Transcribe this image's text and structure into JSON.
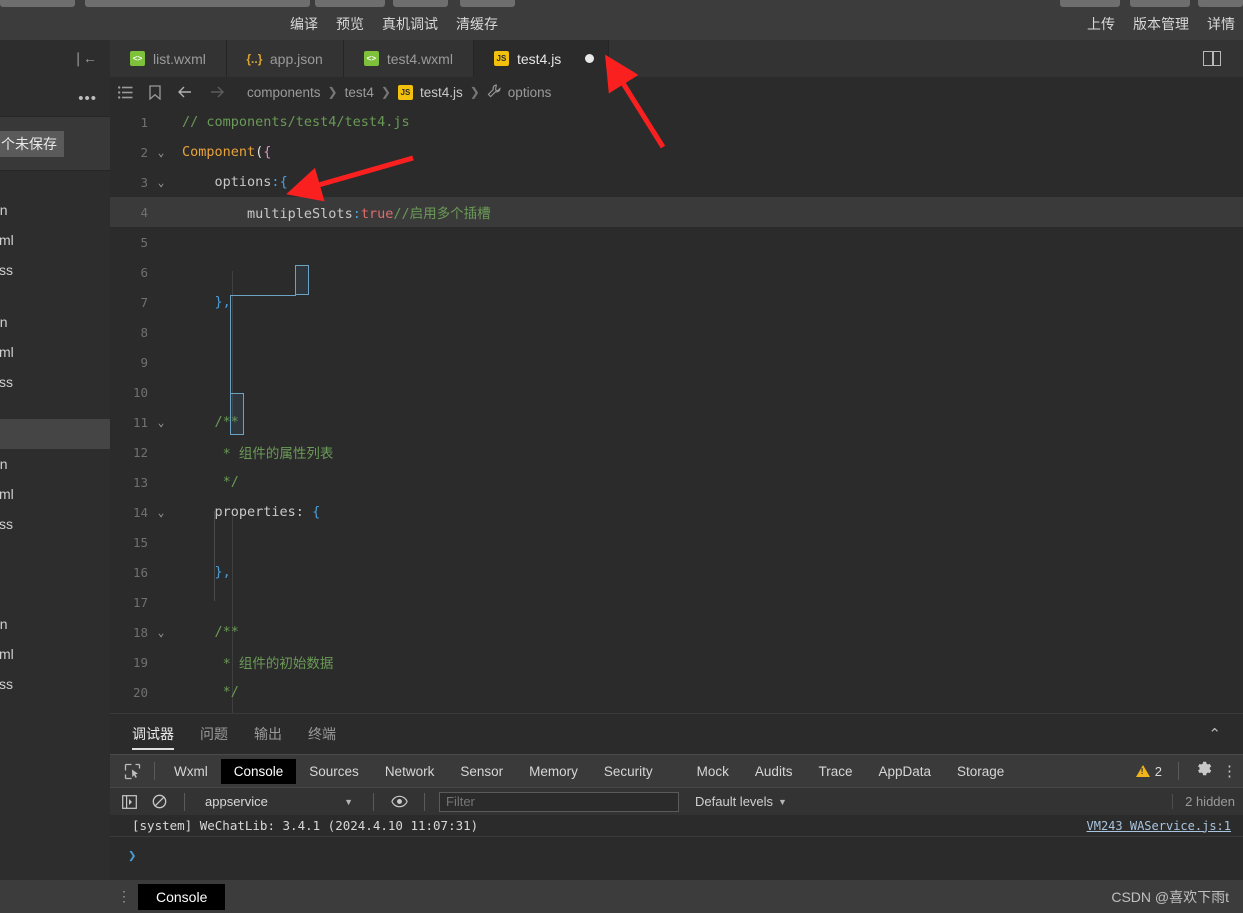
{
  "menubar": {
    "center_items": [
      "编译",
      "预览",
      "真机调试",
      "清缓存"
    ],
    "right_items": [
      "上传",
      "版本管理",
      "详情"
    ]
  },
  "tabbar": {
    "collapse_icon": "collapse-sidebar-icon",
    "tabs": [
      {
        "label": "list.wxml",
        "icon": "wxml-file-icon",
        "icon_text": "<>",
        "kind": "wxml",
        "active": false,
        "dirty": false
      },
      {
        "label": "app.json",
        "icon": "json-file-icon",
        "icon_text": "{..}",
        "kind": "json",
        "active": false,
        "dirty": false
      },
      {
        "label": "test4.wxml",
        "icon": "wxml-file-icon",
        "icon_text": "<>",
        "kind": "wxml",
        "active": false,
        "dirty": false
      },
      {
        "label": "test4.js",
        "icon": "js-file-icon",
        "icon_text": "JS",
        "kind": "js",
        "active": true,
        "dirty": true
      }
    ],
    "split_icon": "split-editor-icon"
  },
  "sidebar": {
    "more_icon": "more-options-icon",
    "chip_label": "个未保存",
    "files_group_1": [
      "on",
      "xml",
      "xss"
    ],
    "files_group_2": [
      "on",
      "xml",
      "xss"
    ],
    "files_group_3": [
      "on",
      "xml",
      "xss"
    ],
    "files_group_4": [
      "on",
      "xml",
      "xss"
    ]
  },
  "editor": {
    "toolbar_icons": [
      "outline-icon",
      "bookmark-icon",
      "back-arrow-icon",
      "forward-arrow-icon"
    ],
    "breadcrumb": [
      {
        "label": "components",
        "icon": null
      },
      {
        "label": "test4",
        "icon": null
      },
      {
        "label": "test4.js",
        "icon": "js-file-icon",
        "icon_text": "JS"
      },
      {
        "label": "options",
        "icon": "wrench-icon"
      }
    ],
    "lines": [
      {
        "n": 1,
        "fold": false,
        "indent": 0,
        "tokens": [
          {
            "t": "// components/test4/test4.js",
            "c": "c-comment"
          }
        ]
      },
      {
        "n": 2,
        "fold": true,
        "indent": 0,
        "tokens": [
          {
            "t": "Component",
            "c": "c-fn"
          },
          {
            "t": "(",
            "c": "c-punct"
          },
          {
            "t": "{",
            "c": "c-brace-pink"
          }
        ]
      },
      {
        "n": 3,
        "fold": true,
        "indent": 1,
        "tokens": [
          {
            "t": "options",
            "c": "c-key"
          },
          {
            "t": ":",
            "c": "c-colon"
          },
          {
            "t": "{",
            "c": "c-brace-blue"
          }
        ]
      },
      {
        "n": 4,
        "fold": false,
        "indent": 2,
        "highlight": true,
        "tokens": [
          {
            "t": "multipleSlots",
            "c": "c-key"
          },
          {
            "t": ":",
            "c": "c-colon"
          },
          {
            "t": "true",
            "c": "c-true"
          },
          {
            "t": "//启用多个插槽",
            "c": "c-comment"
          }
        ]
      },
      {
        "n": 5,
        "fold": false,
        "indent": 0,
        "tokens": []
      },
      {
        "n": 6,
        "fold": false,
        "indent": 0,
        "tokens": []
      },
      {
        "n": 7,
        "fold": false,
        "indent": 1,
        "tokens": [
          {
            "t": "}",
            "c": "c-brace-blue"
          },
          {
            "t": ",",
            "c": "c-brace-blue"
          }
        ]
      },
      {
        "n": 8,
        "fold": false,
        "indent": 0,
        "tokens": []
      },
      {
        "n": 9,
        "fold": false,
        "indent": 0,
        "tokens": []
      },
      {
        "n": 10,
        "fold": false,
        "indent": 0,
        "tokens": []
      },
      {
        "n": 11,
        "fold": true,
        "indent": 1,
        "tokens": [
          {
            "t": "/**",
            "c": "c-comment"
          }
        ]
      },
      {
        "n": 12,
        "fold": false,
        "indent": 1,
        "tokens": [
          {
            "t": " * 组件的属性列表",
            "c": "c-comment"
          }
        ]
      },
      {
        "n": 13,
        "fold": false,
        "indent": 1,
        "tokens": [
          {
            "t": " */",
            "c": "c-comment"
          }
        ]
      },
      {
        "n": 14,
        "fold": true,
        "indent": 1,
        "tokens": [
          {
            "t": "properties: ",
            "c": "c-key"
          },
          {
            "t": "{",
            "c": "c-brace-blue"
          }
        ]
      },
      {
        "n": 15,
        "fold": false,
        "indent": 0,
        "tokens": []
      },
      {
        "n": 16,
        "fold": false,
        "indent": 1,
        "tokens": [
          {
            "t": "}",
            "c": "c-brace-blue"
          },
          {
            "t": ",",
            "c": "c-brace-blue"
          }
        ]
      },
      {
        "n": 17,
        "fold": false,
        "indent": 0,
        "tokens": []
      },
      {
        "n": 18,
        "fold": true,
        "indent": 1,
        "tokens": [
          {
            "t": "/**",
            "c": "c-comment"
          }
        ]
      },
      {
        "n": 19,
        "fold": false,
        "indent": 1,
        "tokens": [
          {
            "t": " * 组件的初始数据",
            "c": "c-comment"
          }
        ]
      },
      {
        "n": 20,
        "fold": false,
        "indent": 1,
        "tokens": [
          {
            "t": " */",
            "c": "c-comment"
          }
        ]
      }
    ]
  },
  "bottom_panel": {
    "tabs": [
      {
        "label": "调试器",
        "active": true
      },
      {
        "label": "问题",
        "active": false
      },
      {
        "label": "输出",
        "active": false
      },
      {
        "label": "终端",
        "active": false
      }
    ],
    "collapse_icon": "chevron-up-icon"
  },
  "devtools": {
    "inspect_icon": "inspect-element-icon",
    "tabs": [
      {
        "label": "Wxml",
        "active": false
      },
      {
        "label": "Console",
        "active": true
      },
      {
        "label": "Sources",
        "active": false
      },
      {
        "label": "Network",
        "active": false
      },
      {
        "label": "Sensor",
        "active": false
      },
      {
        "label": "Memory",
        "active": false
      },
      {
        "label": "Security",
        "active": false
      },
      {
        "label": "Mock",
        "active": false
      },
      {
        "label": "Audits",
        "active": false
      },
      {
        "label": "Trace",
        "active": false
      },
      {
        "label": "AppData",
        "active": false
      },
      {
        "label": "Storage",
        "active": false
      }
    ],
    "warning_count": "2",
    "warning_icon": "warning-triangle-icon",
    "settings_icon": "gear-icon",
    "kebab_icon": "more-vertical-icon"
  },
  "console_toolbar": {
    "sidebar_toggle_icon": "console-sidebar-icon",
    "clear_icon": "clear-console-icon",
    "context_value": "appservice",
    "context_caret": "▼",
    "eye_icon": "live-expression-icon",
    "filter_placeholder": "Filter",
    "filter_value": "",
    "levels_label": "Default levels",
    "levels_caret": "▼",
    "hidden_label": "2 hidden"
  },
  "console_output": {
    "rows": [
      {
        "text": "[system] WeChatLib: 3.4.1 (2024.4.10 11:07:31)",
        "source": "VM243 WAService.js:1"
      }
    ],
    "prompt": "❯"
  },
  "statusbar": {
    "kebab_icon": "more-vertical-icon",
    "console_chip": "Console",
    "watermark": "CSDN @喜欢下雨t"
  },
  "annotations": {
    "arrow_color": "#fb2020",
    "arrow_1_target": "tab-test4js-dirty-dot",
    "arrow_2_target": "code-options-open-brace"
  },
  "colors": {
    "chrome": "#3c3c3c",
    "editor_bg": "#2b2b2b",
    "tabbar_bg": "#333333",
    "sidebar_bg": "#2d2d2d",
    "accent_js": "#f2c10e",
    "accent_wxml": "#7ec13a",
    "comment_green": "#6a9a56",
    "string_red": "#e06c6c",
    "warning_yellow": "#f2b418"
  }
}
